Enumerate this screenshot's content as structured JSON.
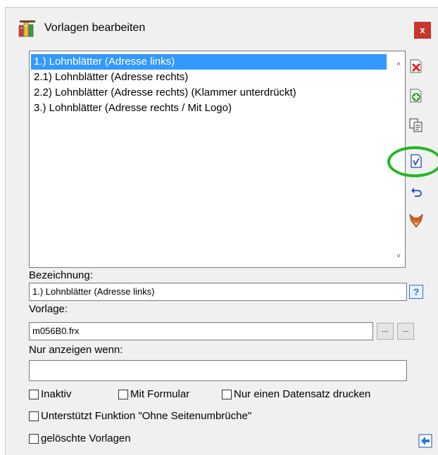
{
  "window": {
    "title": "Vorlagen bearbeiten",
    "close_label": "x"
  },
  "list": {
    "items": [
      "1.) Lohnblätter (Adresse links)",
      "2.1) Lohnblätter (Adresse rechts)",
      "2.2) Lohnblätter (Adresse rechts) (Klammer unterdrückt)",
      "3.) Lohnblätter (Adresse rechts / Mit Logo)"
    ],
    "selected_index": 0
  },
  "fields": {
    "bezeichnung_label": "Bezeichnung:",
    "bezeichnung_value": "1.) Lohnblätter (Adresse links)",
    "vorlage_label": "Vorlage:",
    "vorlage_value": "m056B0.frx",
    "browse1_label": "...",
    "browse2_label": "...",
    "nur_anzeigen_label": "Nur anzeigen wenn:",
    "nur_anzeigen_value": ""
  },
  "checkboxes": {
    "inaktiv": "Inaktiv",
    "mit_formular": "Mit Formular",
    "nur_einen": "Nur einen Datensatz drucken",
    "ohne_umbrueche": "Unterstützt Funktion \"Ohne Seitenumbrüche\"",
    "geloeschte": "gelöschte Vorlagen"
  },
  "help_label": "?",
  "colors": {
    "selection": "#3399ff",
    "close": "#c7362b",
    "highlight": "#22b822"
  }
}
